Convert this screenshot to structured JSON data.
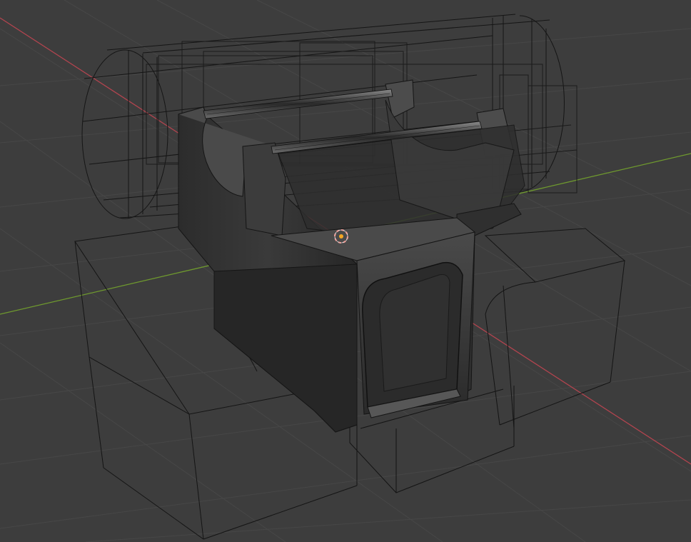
{
  "viewport": {
    "mode": "3d-viewport",
    "shading": "x-ray solid",
    "colors": {
      "background": "#3d3d3d",
      "grid": "#474747",
      "x_axis": "#b3444f",
      "y_axis": "#6f9a2e",
      "wire": "#141414",
      "solid_dark": "#262626",
      "solid_mid": "#363636",
      "solid_light": "#5a5a5a",
      "cursor_ring": "#f0a09a",
      "origin_dot": "#f5a623"
    },
    "objects": [
      {
        "name": "cylinder-wireframe"
      },
      {
        "name": "left-block-wireframe"
      },
      {
        "name": "center-block-wireframe"
      },
      {
        "name": "right-block-wireframe"
      },
      {
        "name": "bracket-solid"
      },
      {
        "name": "rail-rods"
      }
    ],
    "cursor_icon": "3d-cursor-icon"
  }
}
